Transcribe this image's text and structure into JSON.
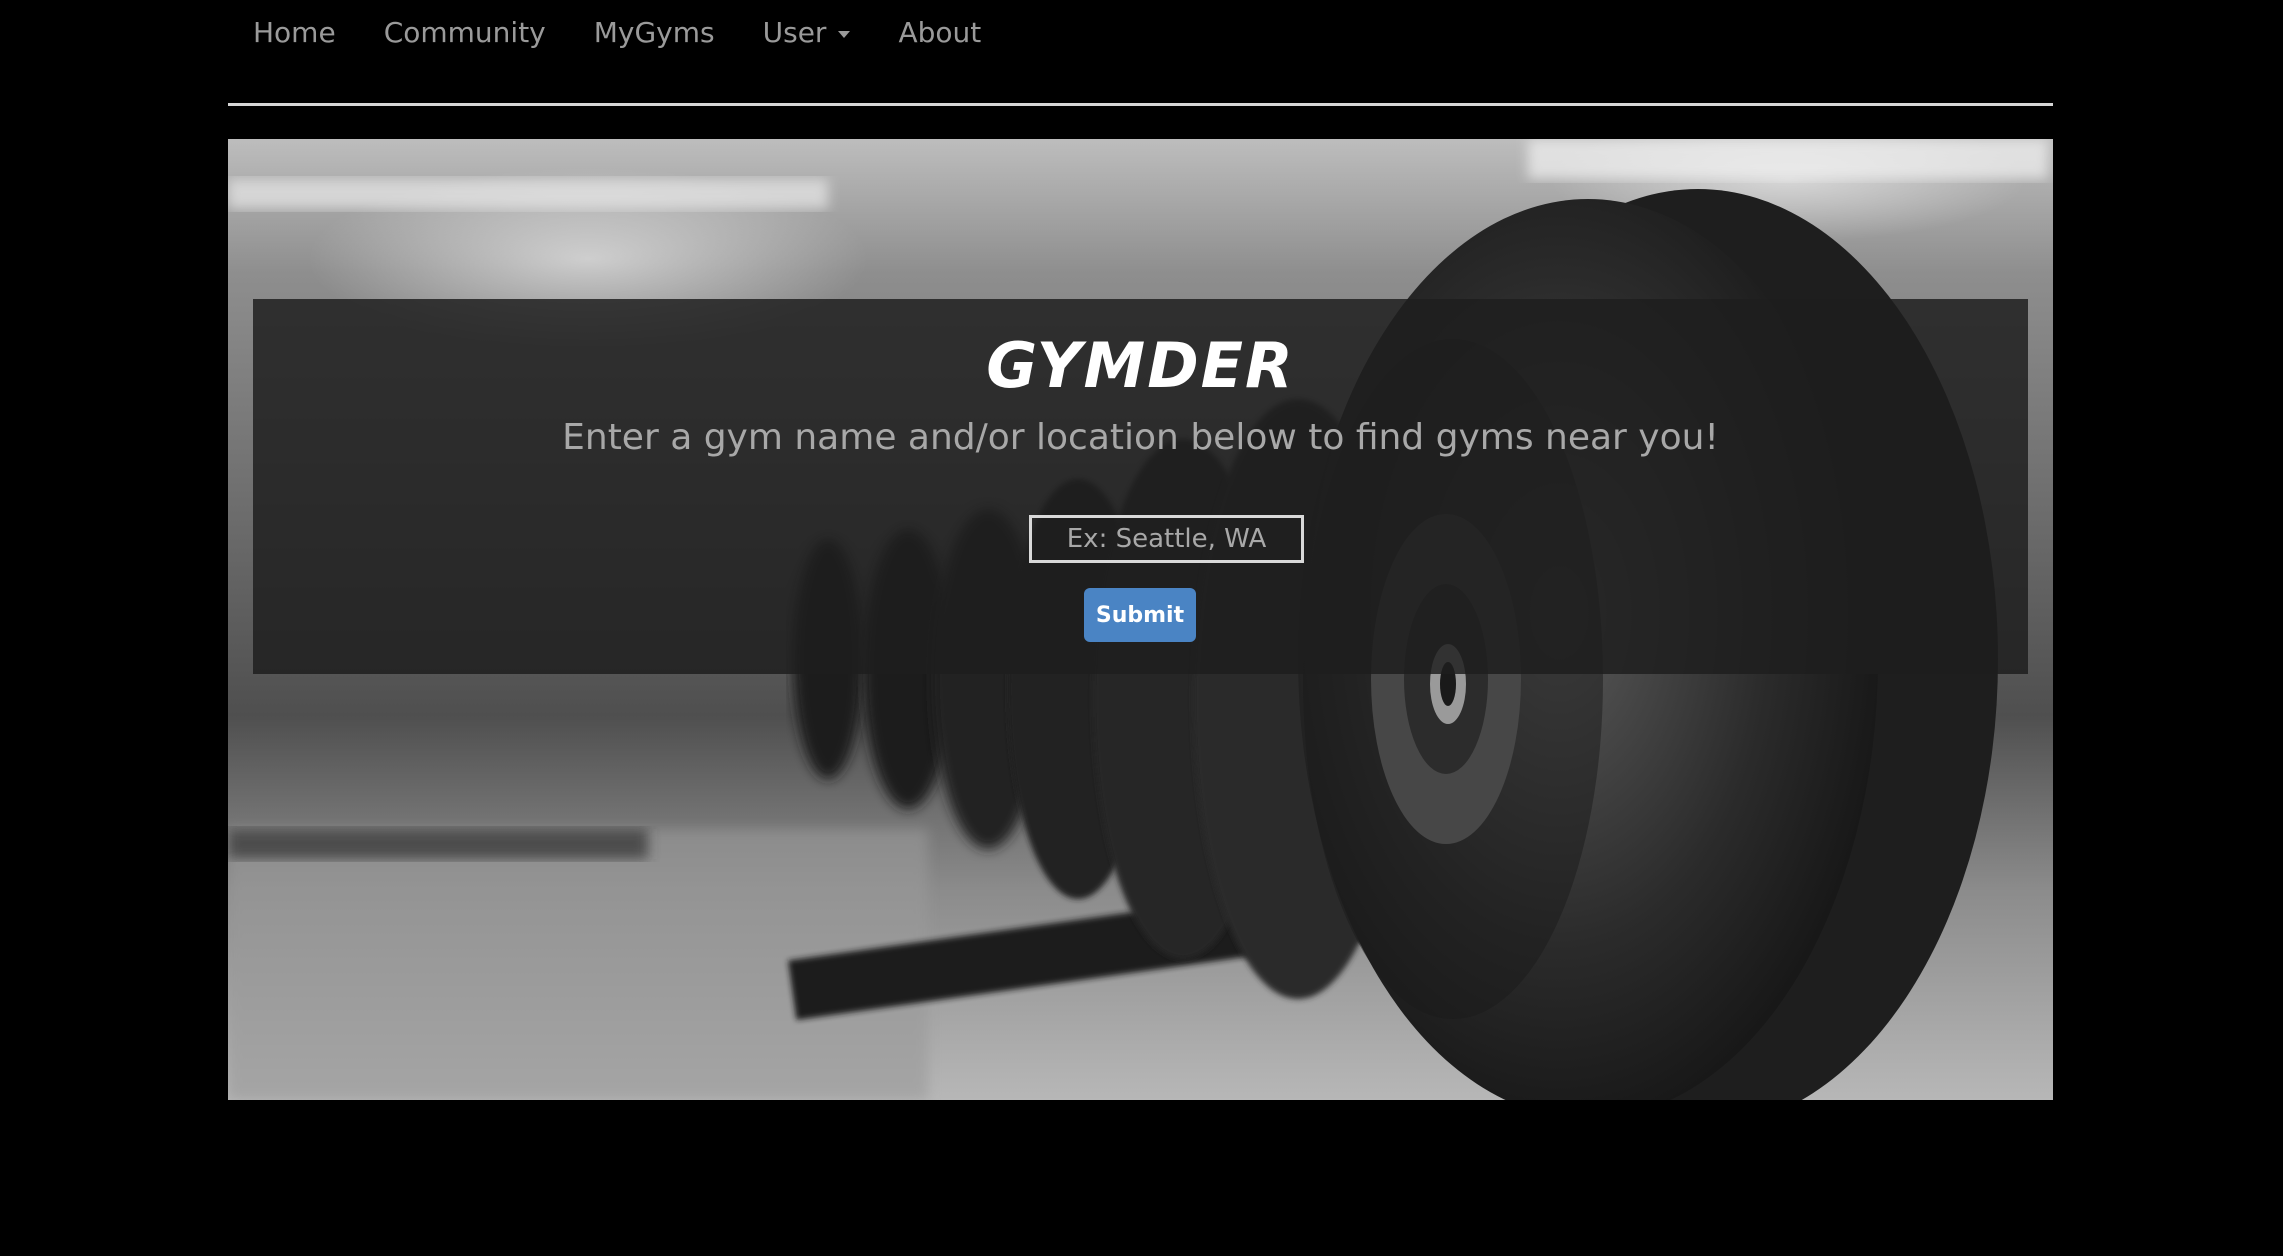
{
  "nav": {
    "items": [
      {
        "label": "Home"
      },
      {
        "label": "Community"
      },
      {
        "label": "MyGyms"
      },
      {
        "label": "User",
        "has_dropdown": true
      },
      {
        "label": "About"
      }
    ]
  },
  "hero": {
    "brand": "GYMDER",
    "tagline": "Enter a gym name and/or location below to find gyms near you!",
    "search": {
      "placeholder": "Ex: Seattle, WA",
      "value": ""
    },
    "submit_label": "Submit",
    "background_image": "dumbbell-rack-photo"
  },
  "colors": {
    "background": "#000000",
    "nav_text": "#9a9a9a",
    "nav_divider": "#d6d6d6",
    "overlay": "#1e1e1e",
    "button": "#4a84c4"
  }
}
